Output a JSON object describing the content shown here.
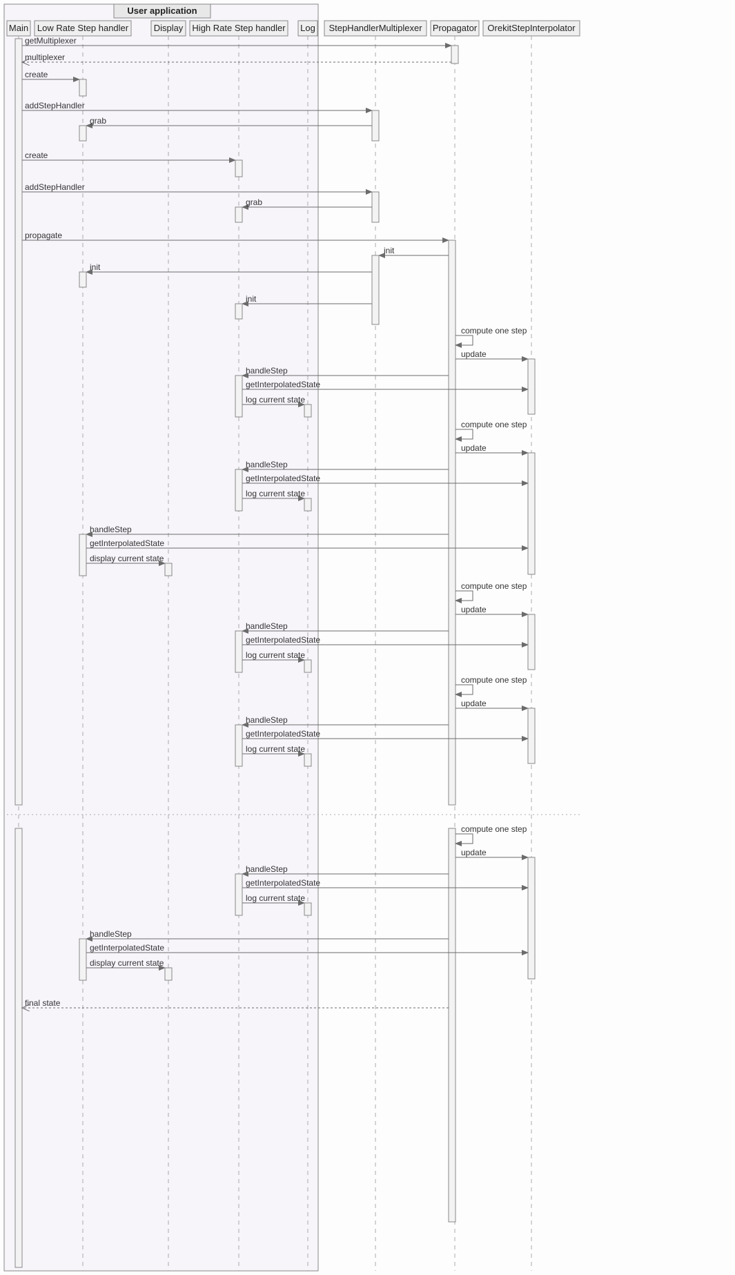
{
  "diagram": {
    "groupTitle": "User application",
    "participants": {
      "main": "Main",
      "low": "Low Rate Step handler",
      "disp": "Display",
      "high": "High Rate Step handler",
      "log": "Log",
      "mux": "StepHandlerMultiplexer",
      "prop": "Propagator",
      "interp": "OrekitStepInterpolator"
    },
    "messages": {
      "getMux": "getMultiplexer",
      "muxReturn": "multiplexer",
      "create": "create",
      "addSH": "addStepHandler",
      "grab": "grab",
      "propagate": "propagate",
      "init": "init",
      "compute": "compute one step",
      "update": "update",
      "handleStep": "handleStep",
      "getInterp": "getInterpolatedState",
      "logCur": "log current state",
      "dispCur": "display current state",
      "finalState": "final state"
    }
  }
}
